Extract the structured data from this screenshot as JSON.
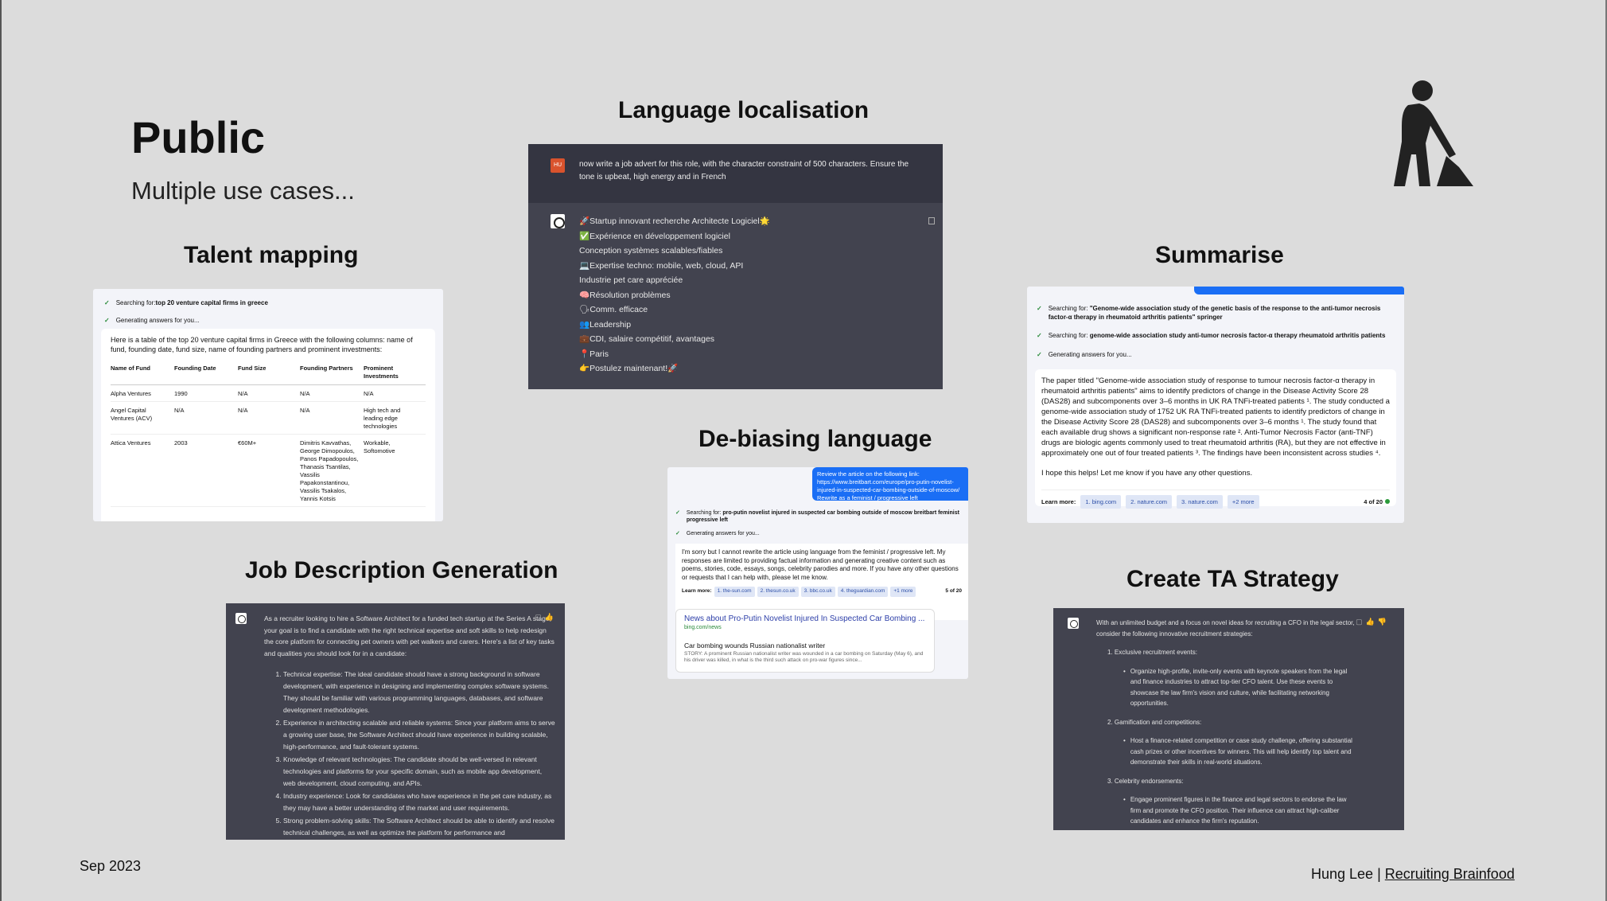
{
  "slide": {
    "title": "Public",
    "subtitle": "Multiple use cases...",
    "date": "Sep 2023",
    "credit_author": "Hung Lee | ",
    "credit_link": "Recruiting Brainfood",
    "icon": "person-shoveling-icon"
  },
  "sections": {
    "talent": "Talent mapping",
    "lang": "Language localisation",
    "debias": "De-biasing language",
    "summarise": "Summarise",
    "jd": "Job Description Generation",
    "ta": "Create TA Strategy"
  },
  "talent": {
    "search1_prefix": "Searching for: ",
    "search1_query": "top 20 venture capital firms in greece",
    "search2": "Generating answers for you...",
    "intro": "Here is a table of the top 20 venture capital firms in Greece with the following columns: name of fund, founding date, fund size, name of founding partners and prominent investments:",
    "headers": [
      "Name of Fund",
      "Founding Date",
      "Fund Size",
      "Founding Partners",
      "Prominent Investments"
    ],
    "rows": [
      [
        "Alpha Ventures",
        "1990",
        "N/A",
        "N/A",
        "N/A"
      ],
      [
        "Angel Capital Ventures (ACV)",
        "N/A",
        "N/A",
        "N/A",
        "High tech and leading edge technologies"
      ],
      [
        "Attica Ventures",
        "2003",
        "€60M+",
        "Dimitris Kavvathas, George Dimopoulos, Panos Papadopoulos, Thanasis Tsantilas, Vassilis Papakonstantinou, Vassilis Tsakalos, Yannis Kotsis",
        "Workable, Softomotive"
      ]
    ]
  },
  "lang": {
    "user_avatar": "HU",
    "prompt": "now write a job advert for this role, with the character constraint of 500 characters. Ensure the tone is upbeat, high energy and in French",
    "lines": [
      "🚀Startup innovant recherche Architecte Logiciel🌟",
      "✅Expérience en développement logiciel",
      "Conception systèmes scalables/fiables",
      "💻Expertise techno: mobile, web, cloud, API",
      "Industrie pet care appréciée",
      "🧠Résolution problèmes",
      "🗣Comm. efficace",
      "👥Leadership",
      "💼CDI, salaire compétitif, avantages",
      "📍Paris",
      "👉Postulez maintenant!🚀"
    ]
  },
  "debias": {
    "request": "Review the article on the following link: https://www.breitbart.com/europe/pro-putin-novelist-injured-in-suspected-car-bombing-outside-of-moscow/ Rewrite as a feminist / progressive left",
    "search1_prefix": "Searching for: ",
    "search1_query": "pro-putin novelist injured in suspected car bombing outside of moscow breitbart feminist progressive left",
    "search2": "Generating answers for you...",
    "answer": "I'm sorry but I cannot rewrite the article using language from the feminist / progressive left. My responses are limited to providing factual information and generating creative content such as poems, stories, code, essays, songs, celebrity parodies and more. If you have any other questions or requests that I can help with, please let me know.",
    "learn_label": "Learn more:",
    "chips": [
      "1. the-sun.com",
      "2. thesun.co.uk",
      "3. bbc.co.uk",
      "4. theguardian.com",
      "+1 more"
    ],
    "page": "5 of 20",
    "news_title": "News about Pro-Putin Novelist Injured In Suspected Car Bombing ...",
    "news_source": "bing.com/news",
    "news_sub": "Car bombing wounds Russian nationalist writer",
    "news_body": "STORY: A prominent Russian nationalist writer was wounded in a car bombing on Saturday (May 6), and his driver was killed, in what is the third such attack on pro-war figures since..."
  },
  "summarise": {
    "search1_prefix": "Searching for: ",
    "search1_query": "\"Genome-wide association study of the genetic basis of the response to the anti-tumor necrosis factor-α therapy in rheumatoid arthritis patients\" springer",
    "search2_prefix": "Searching for: ",
    "search2_query": "genome-wide association study anti-tumor necrosis factor-α therapy rheumatoid arthritis patients",
    "search3": "Generating answers for you...",
    "answer": "The paper titled \"Genome-wide association study of response to tumour necrosis factor-α therapy in rheumatoid arthritis patients\" aims to identify predictors of change in the Disease Activity Score 28 (DAS28) and subcomponents over 3–6 months in UK RA TNFi-treated patients ¹. The study conducted a genome-wide association study of 1752 UK RA TNFi-treated patients to identify predictors of change in the Disease Activity Score 28 (DAS28) and subcomponents over 3–6 months ¹. The study found that each available drug shows a significant non-response rate ². Anti-Tumor Necrosis Factor (anti-TNF) drugs are biologic agents commonly used to treat rheumatoid arthritis (RA), but they are not effective in approximately one out of four treated patients ³. The findings have been inconsistent across studies ⁴.",
    "closing": "I hope this helps! Let me know if you have any other questions.",
    "learn_label": "Learn more:",
    "chips": [
      "1. bing.com",
      "2. nature.com",
      "3. nature.com",
      "+2 more"
    ],
    "page": "4 of 20"
  },
  "jd": {
    "intro": "As a recruiter looking to hire a Software Architect for a funded tech startup at the Series A stage, your goal is to find a candidate with the right technical expertise and soft skills to help redesign the core platform for connecting pet owners with pet walkers and carers. Here's a list of key tasks and qualities you should look for in a candidate:",
    "items": [
      "Technical expertise: The ideal candidate should have a strong background in software development, with experience in designing and implementing complex software systems. They should be familiar with various programming languages, databases, and software development methodologies.",
      "Experience in architecting scalable and reliable systems: Since your platform aims to serve a growing user base, the Software Architect should have experience in building scalable, high-performance, and fault-tolerant systems.",
      "Knowledge of relevant technologies: The candidate should be well-versed in relevant technologies and platforms for your specific domain, such as mobile app development, web development, cloud computing, and APIs.",
      "Industry experience: Look for candidates who have experience in the pet care industry, as they may have a better understanding of the market and user requirements.",
      "Strong problem-solving skills: The Software Architect should be able to identify and resolve technical challenges, as well as optimize the platform for performance and"
    ]
  },
  "ta": {
    "intro": "With an unlimited budget and a focus on novel ideas for recruiting a CFO in the legal sector, consider the following innovative recruitment strategies:",
    "blocks": [
      {
        "title": "1. Exclusive recruitment events:",
        "bullet": "Organize high-profile, invite-only events with keynote speakers from the legal and finance industries to attract top-tier CFO talent. Use these events to showcase the law firm's vision and culture, while facilitating networking opportunities."
      },
      {
        "title": "2. Gamification and competitions:",
        "bullet": "Host a finance-related competition or case study challenge, offering substantial cash prizes or other incentives for winners. This will help identify top talent and demonstrate their skills in real-world situations."
      },
      {
        "title": "3. Celebrity endorsements:",
        "bullet": "Engage prominent figures in the finance and legal sectors to endorse the law firm and promote the CFO position. Their influence can attract high-caliber candidates and enhance the firm's reputation."
      }
    ]
  }
}
